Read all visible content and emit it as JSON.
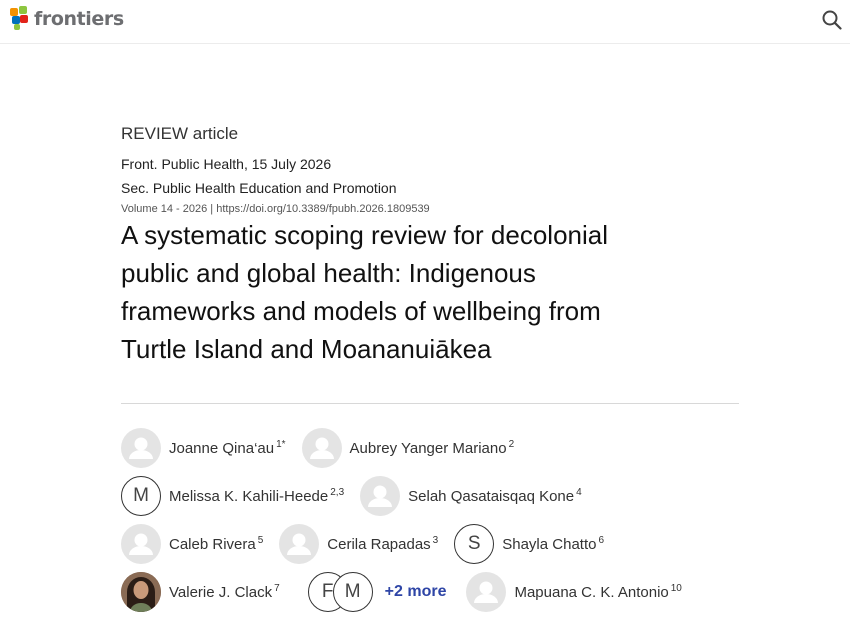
{
  "header": {
    "logo_text": "frontiers",
    "search_icon": "search-icon"
  },
  "article": {
    "type": "REVIEW article",
    "journal_date": "Front. Public Health, 15 July 2026",
    "section": "Sec. Public Health Education and Promotion",
    "volume": "Volume 14 - 2026",
    "separator": "|",
    "doi": "https://doi.org/10.3389/fpubh.2026.1809539",
    "title_lines": [
      "A systematic scoping review for decolonial",
      "public and global health: Indigenous",
      "frameworks and models of wellbeing from",
      "Turtle Island and Moananuiākea"
    ]
  },
  "authors": [
    {
      "name": "Joanne Qina‘au",
      "sup": "1*",
      "avatar": "generic"
    },
    {
      "name": "Aubrey Yanger Mariano",
      "sup": "2",
      "avatar": "generic"
    },
    {
      "name": "Melissa K. Kahili-Heede",
      "sup": "2,3",
      "avatar": "initial",
      "initial": "M"
    },
    {
      "name": "Selah Qasataisqaq Kone",
      "sup": "4",
      "avatar": "generic"
    },
    {
      "name": "Caleb Rivera",
      "sup": "5",
      "avatar": "generic"
    },
    {
      "name": "Cerila Rapadas",
      "sup": "3",
      "avatar": "generic"
    },
    {
      "name": "Shayla Chatto",
      "sup": "6",
      "avatar": "initial",
      "initial": "S"
    },
    {
      "name": "Valerie J. Clack",
      "sup": "7",
      "avatar": "photo"
    },
    {
      "name": "Mapuana C. K. Antonio",
      "sup": "10",
      "avatar": "generic"
    }
  ],
  "more_authors": {
    "initials": [
      "F",
      "M"
    ],
    "label": "+2 more"
  },
  "colors": {
    "brand_gray": "#6d6e71",
    "link_blue": "#2e45a6",
    "logo_orange": "#f39200",
    "logo_green": "#8dc63f",
    "logo_red": "#e2231a",
    "logo_blue": "#0071bc"
  }
}
